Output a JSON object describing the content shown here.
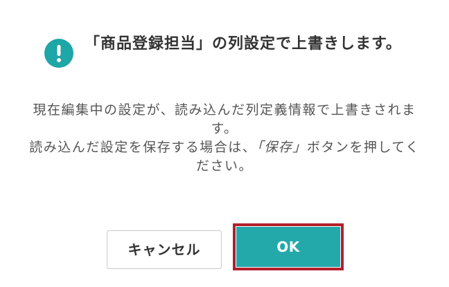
{
  "dialog": {
    "title": "「商品登録担当」の列設定で上書きします。",
    "message_line1": "現在編集中の設定が、読み込んだ列定義情報で上書きされます。",
    "message_line2_before": "読み込んだ設定を保存する場合は、",
    "message_line2_emphasis": "「保存」",
    "message_line2_after": "ボタンを押してください。",
    "cancel_label": "キャンセル",
    "ok_label": "OK",
    "icon": "info-icon",
    "colors": {
      "accent": "#23a9aa",
      "highlight_border": "#b21f2d"
    }
  }
}
